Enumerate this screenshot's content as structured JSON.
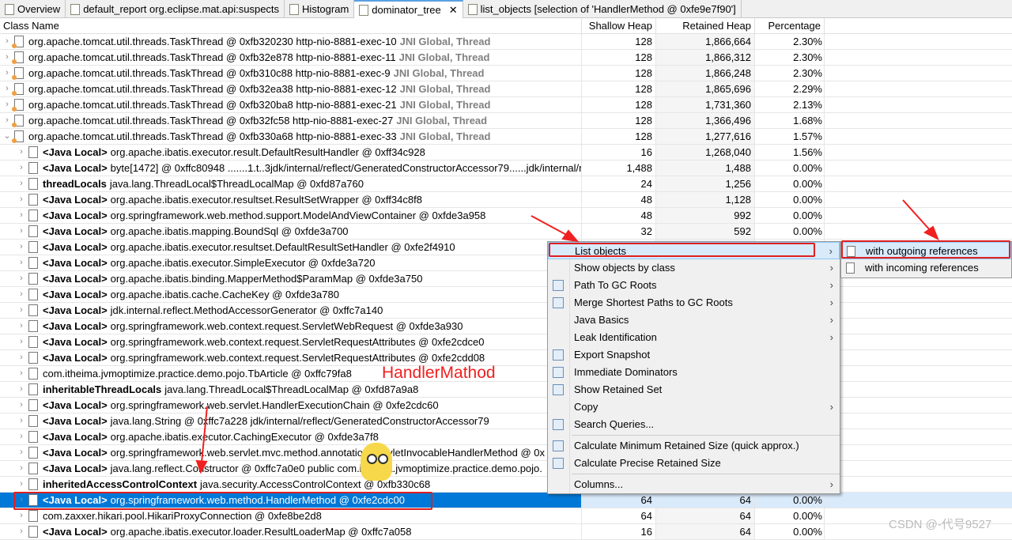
{
  "tabs": [
    {
      "label": "Overview",
      "icon": "info-icon"
    },
    {
      "label": "default_report org.eclipse.mat.api:suspects",
      "icon": "report-icon"
    },
    {
      "label": "Histogram",
      "icon": "histogram-icon"
    },
    {
      "label": "dominator_tree",
      "icon": "tree-icon",
      "active": true,
      "close": "✕"
    },
    {
      "label": "list_objects [selection of 'HandlerMethod @ 0xfe9e7f90']",
      "icon": "list-objects-icon"
    }
  ],
  "columns": [
    "Class Name",
    "Shallow Heap",
    "Retained Heap",
    "Percentage"
  ],
  "rows": [
    {
      "pre": "",
      "name": "org.apache.tomcat.util.threads.TaskThread @ 0xfb320230  http-nio-8881-exec-10",
      "tag": "JNI Global, Thread",
      "shallow": "128",
      "retained": "1,866,664",
      "pct": "2.30%",
      "exp": "›",
      "type": "thread"
    },
    {
      "pre": "",
      "name": "org.apache.tomcat.util.threads.TaskThread @ 0xfb32e878  http-nio-8881-exec-11",
      "tag": "JNI Global, Thread",
      "shallow": "128",
      "retained": "1,866,312",
      "pct": "2.30%",
      "exp": "›",
      "type": "thread"
    },
    {
      "pre": "",
      "name": "org.apache.tomcat.util.threads.TaskThread @ 0xfb310c88  http-nio-8881-exec-9",
      "tag": "JNI Global, Thread",
      "shallow": "128",
      "retained": "1,866,248",
      "pct": "2.30%",
      "exp": "›",
      "type": "thread"
    },
    {
      "pre": "",
      "name": "org.apache.tomcat.util.threads.TaskThread @ 0xfb32ea38  http-nio-8881-exec-12",
      "tag": "JNI Global, Thread",
      "shallow": "128",
      "retained": "1,865,696",
      "pct": "2.29%",
      "exp": "›",
      "type": "thread"
    },
    {
      "pre": "",
      "name": "org.apache.tomcat.util.threads.TaskThread @ 0xfb320ba8  http-nio-8881-exec-21",
      "tag": "JNI Global, Thread",
      "shallow": "128",
      "retained": "1,731,360",
      "pct": "2.13%",
      "exp": "›",
      "type": "thread"
    },
    {
      "pre": "",
      "name": "org.apache.tomcat.util.threads.TaskThread @ 0xfb32fc58  http-nio-8881-exec-27",
      "tag": "JNI Global, Thread",
      "shallow": "128",
      "retained": "1,366,496",
      "pct": "1.68%",
      "exp": "›",
      "type": "thread"
    },
    {
      "pre": "",
      "name": "org.apache.tomcat.util.threads.TaskThread @ 0xfb330a68  http-nio-8881-exec-33",
      "tag": "JNI Global, Thread",
      "shallow": "128",
      "retained": "1,277,616",
      "pct": "1.57%",
      "exp": "⌄",
      "type": "thread"
    },
    {
      "pre": "<Java Local>",
      "name": "org.apache.ibatis.executor.result.DefaultResultHandler @ 0xff34c928",
      "shallow": "16",
      "retained": "1,268,040",
      "pct": "1.56%",
      "exp": "›"
    },
    {
      "pre": "<Java Local>",
      "name": "byte[1472] @ 0xffc80948  .......1.t..3jdk/internal/reflect/GeneratedConstructorAccessor79......jdk/internal/r",
      "shallow": "1,488",
      "retained": "1,488",
      "pct": "0.00%",
      "exp": "›"
    },
    {
      "pre": "threadLocals",
      "name": "java.lang.ThreadLocal$ThreadLocalMap @ 0xfd87a760",
      "shallow": "24",
      "retained": "1,256",
      "pct": "0.00%",
      "exp": "›"
    },
    {
      "pre": "<Java Local>",
      "name": "org.apache.ibatis.executor.resultset.ResultSetWrapper @ 0xff34c8f8",
      "shallow": "48",
      "retained": "1,128",
      "pct": "0.00%",
      "exp": "›"
    },
    {
      "pre": "<Java Local>",
      "name": "org.springframework.web.method.support.ModelAndViewContainer @ 0xfde3a958",
      "shallow": "48",
      "retained": "992",
      "pct": "0.00%",
      "exp": "›"
    },
    {
      "pre": "<Java Local>",
      "name": "org.apache.ibatis.mapping.BoundSql @ 0xfde3a700",
      "shallow": "32",
      "retained": "592",
      "pct": "0.00%",
      "exp": "›"
    },
    {
      "pre": "<Java Local>",
      "name": "org.apache.ibatis.executor.resultset.DefaultResultSetHandler @ 0xfe2f4910",
      "exp": "›"
    },
    {
      "pre": "<Java Local>",
      "name": "org.apache.ibatis.executor.SimpleExecutor @ 0xfde3a720",
      "exp": "›"
    },
    {
      "pre": "<Java Local>",
      "name": "org.apache.ibatis.binding.MapperMethod$ParamMap @ 0xfde3a750",
      "exp": "›"
    },
    {
      "pre": "<Java Local>",
      "name": "org.apache.ibatis.cache.CacheKey @ 0xfde3a780",
      "exp": "›"
    },
    {
      "pre": "<Java Local>",
      "name": "jdk.internal.reflect.MethodAccessorGenerator @ 0xffc7a140",
      "exp": "›"
    },
    {
      "pre": "<Java Local>",
      "name": "org.springframework.web.context.request.ServletWebRequest @ 0xfde3a930",
      "exp": "›"
    },
    {
      "pre": "<Java Local>",
      "name": "org.springframework.web.context.request.ServletRequestAttributes @ 0xfe2cdce0",
      "exp": "›"
    },
    {
      "pre": "<Java Local>",
      "name": "org.springframework.web.context.request.ServletRequestAttributes @ 0xfe2cdd08",
      "exp": "›"
    },
    {
      "pre": "",
      "name": "com.itheima.jvmoptimize.practice.demo.pojo.TbArticle @ 0xffc79fa8",
      "exp": "›"
    },
    {
      "pre": "inheritableThreadLocals",
      "name": "java.lang.ThreadLocal$ThreadLocalMap @ 0xfd87a9a8",
      "exp": "›"
    },
    {
      "pre": "<Java Local>",
      "name": "org.springframework.web.servlet.HandlerExecutionChain @ 0xfe2cdc60",
      "exp": "›"
    },
    {
      "pre": "<Java Local>",
      "name": "java.lang.String @ 0xffc7a228  jdk/internal/reflect/GeneratedConstructorAccessor79",
      "exp": "›"
    },
    {
      "pre": "<Java Local>",
      "name": "org.apache.ibatis.executor.CachingExecutor @ 0xfde3a7f8",
      "exp": "›"
    },
    {
      "pre": "<Java Local>",
      "name": "org.springframework.web.servlet.mvc.method.annotation.ServletInvocableHandlerMethod @ 0x",
      "exp": "›"
    },
    {
      "pre": "<Java Local>",
      "name": "java.lang.reflect.Constructor @ 0xffc7a0e0  public com.itheima.jvmoptimize.practice.demo.pojo.",
      "exp": "›"
    },
    {
      "pre": "inheritedAccessControlContext",
      "name": "java.security.AccessControlContext @ 0xfb330c68",
      "exp": "›"
    },
    {
      "pre": "<Java Local>",
      "name": "org.springframework.web.method.HandlerMethod @ 0xfe2cdc00",
      "shallow": "64",
      "retained": "64",
      "pct": "0.00%",
      "exp": "›",
      "selected": true
    },
    {
      "pre": "",
      "name": "com.zaxxer.hikari.pool.HikariProxyConnection @ 0xfe8be2d8",
      "shallow": "64",
      "retained": "64",
      "pct": "0.00%",
      "exp": "›"
    },
    {
      "pre": "<Java Local>",
      "name": "org.apache.ibatis.executor.loader.ResultLoaderMap @ 0xffc7a058",
      "shallow": "16",
      "retained": "64",
      "pct": "0.00%",
      "exp": "›"
    }
  ],
  "menu": [
    {
      "label": "List objects",
      "sub": true,
      "hl": true
    },
    {
      "label": "Show objects by class",
      "sub": true
    },
    {
      "label": "Path To GC Roots",
      "sub": true,
      "icon": "path-gc-roots-icon"
    },
    {
      "label": "Merge Shortest Paths to GC Roots",
      "sub": true,
      "icon": "merge-paths-icon"
    },
    {
      "label": "Java Basics",
      "sub": true
    },
    {
      "label": "Leak Identification",
      "sub": true
    },
    {
      "label": "Export Snapshot",
      "icon": "export-snapshot-icon"
    },
    {
      "label": "Immediate Dominators",
      "icon": "immediate-dominators-icon"
    },
    {
      "label": "Show Retained Set",
      "icon": "retained-set-icon"
    },
    {
      "label": "Copy",
      "sub": true
    },
    {
      "label": "Search Queries...",
      "icon": "search-queries-icon",
      "sep_after": true
    },
    {
      "label": "Calculate Minimum Retained Size (quick approx.)",
      "icon": "calculator-icon"
    },
    {
      "label": "Calculate Precise Retained Size",
      "icon": "calculator-icon",
      "sep_after": true
    },
    {
      "label": "Columns...",
      "sub": true
    }
  ],
  "submenu": [
    {
      "label": "with outgoing references",
      "hl": true
    },
    {
      "label": "with incoming references"
    }
  ],
  "annotation": "HandlerMathod",
  "watermark": "CSDN @-代号9527",
  "colors": {
    "selection": "#0078d7",
    "highlight": "#d9eafb",
    "annotation": "#f02020"
  }
}
